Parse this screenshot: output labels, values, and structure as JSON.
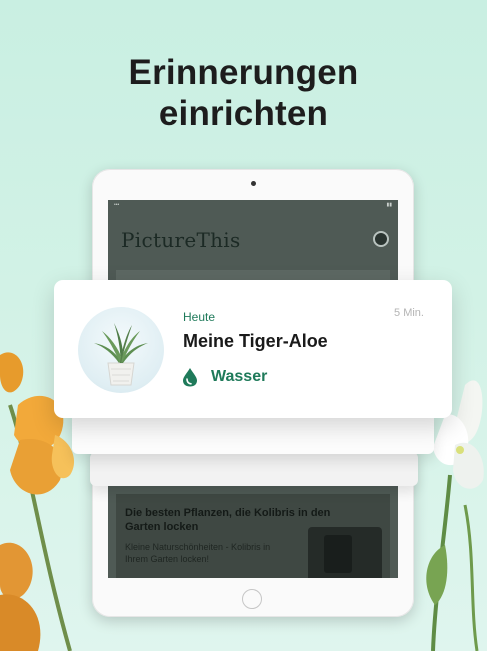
{
  "headline": {
    "line1": "Erinnerungen",
    "line2": "einrichten"
  },
  "device": {
    "app_logo": "PictureThis",
    "article": {
      "title": "Die besten Pflanzen, die Kolibris in den Garten locken",
      "description": "Kleine Naturschönheiten - Kolibris in Ihrem Garten locken!"
    }
  },
  "notification": {
    "label": "Heute",
    "time": "5 Min.",
    "title": "Meine Tiger-Aloe",
    "action": "Wasser"
  },
  "icons": {
    "action": "water-drop-icon",
    "profile": "profile-icon",
    "plant": "aloe-plant-icon"
  },
  "colors": {
    "accent": "#1f7a5a",
    "background": "#cdf0e4"
  }
}
